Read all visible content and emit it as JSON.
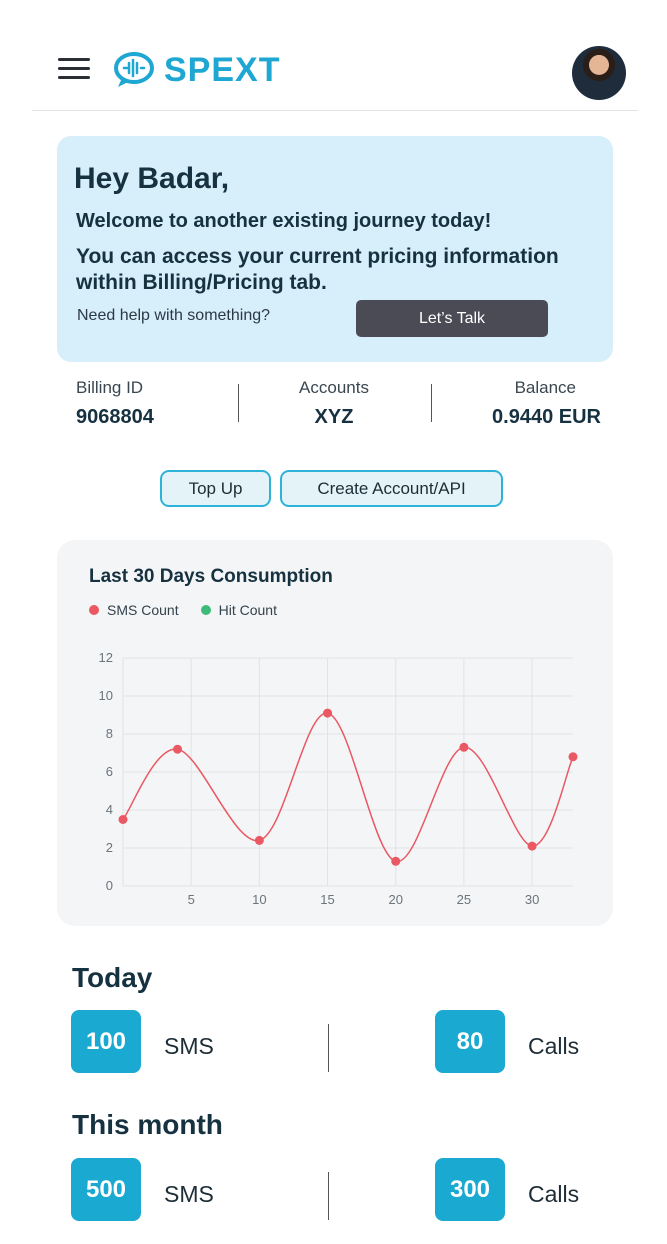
{
  "header": {
    "brand": "SPEXT",
    "logo_icon": "waveform-chat-icon",
    "menu_icon": "hamburger-icon"
  },
  "welcome": {
    "greeting": "Hey Badar,",
    "line1": "Welcome to another existing journey today!",
    "line2": "You can access your current pricing information within Billing/Pricing tab.",
    "help_text": "Need help with something?",
    "talk_button": "Let’s Talk"
  },
  "stats": [
    {
      "label": "Billing ID",
      "value": "9068804"
    },
    {
      "label": "Accounts",
      "value": "XYZ"
    },
    {
      "label": "Balance",
      "value": "0.9440 EUR"
    }
  ],
  "actions": {
    "top_up": "Top Up",
    "create": "Create Account/API"
  },
  "chart_data": {
    "type": "line",
    "title": "Last 30 Days Consumption",
    "series": [
      {
        "name": "SMS Count",
        "color": "#e95863",
        "x": [
          0,
          4,
          10,
          15,
          20,
          25,
          30,
          33
        ],
        "values": [
          3.5,
          7.2,
          2.4,
          9.1,
          1.3,
          7.3,
          2.1,
          6.8
        ]
      },
      {
        "name": "Hit Count",
        "color": "#3dbb78",
        "x": [],
        "values": []
      }
    ],
    "x_ticks": [
      "5",
      "10",
      "15",
      "20",
      "25",
      "30"
    ],
    "y_ticks": [
      "0",
      "2",
      "4",
      "6",
      "8",
      "10",
      "12"
    ],
    "xlim": [
      0,
      33
    ],
    "ylim": [
      0,
      12
    ],
    "grid": true,
    "legend": "top-left"
  },
  "today": {
    "title": "Today",
    "sms_count": "100",
    "sms_label": "SMS",
    "calls_count": "80",
    "calls_label": "Calls"
  },
  "month": {
    "title": "This month",
    "sms_count": "500",
    "sms_label": "SMS",
    "calls_count": "300",
    "calls_label": "Calls"
  }
}
